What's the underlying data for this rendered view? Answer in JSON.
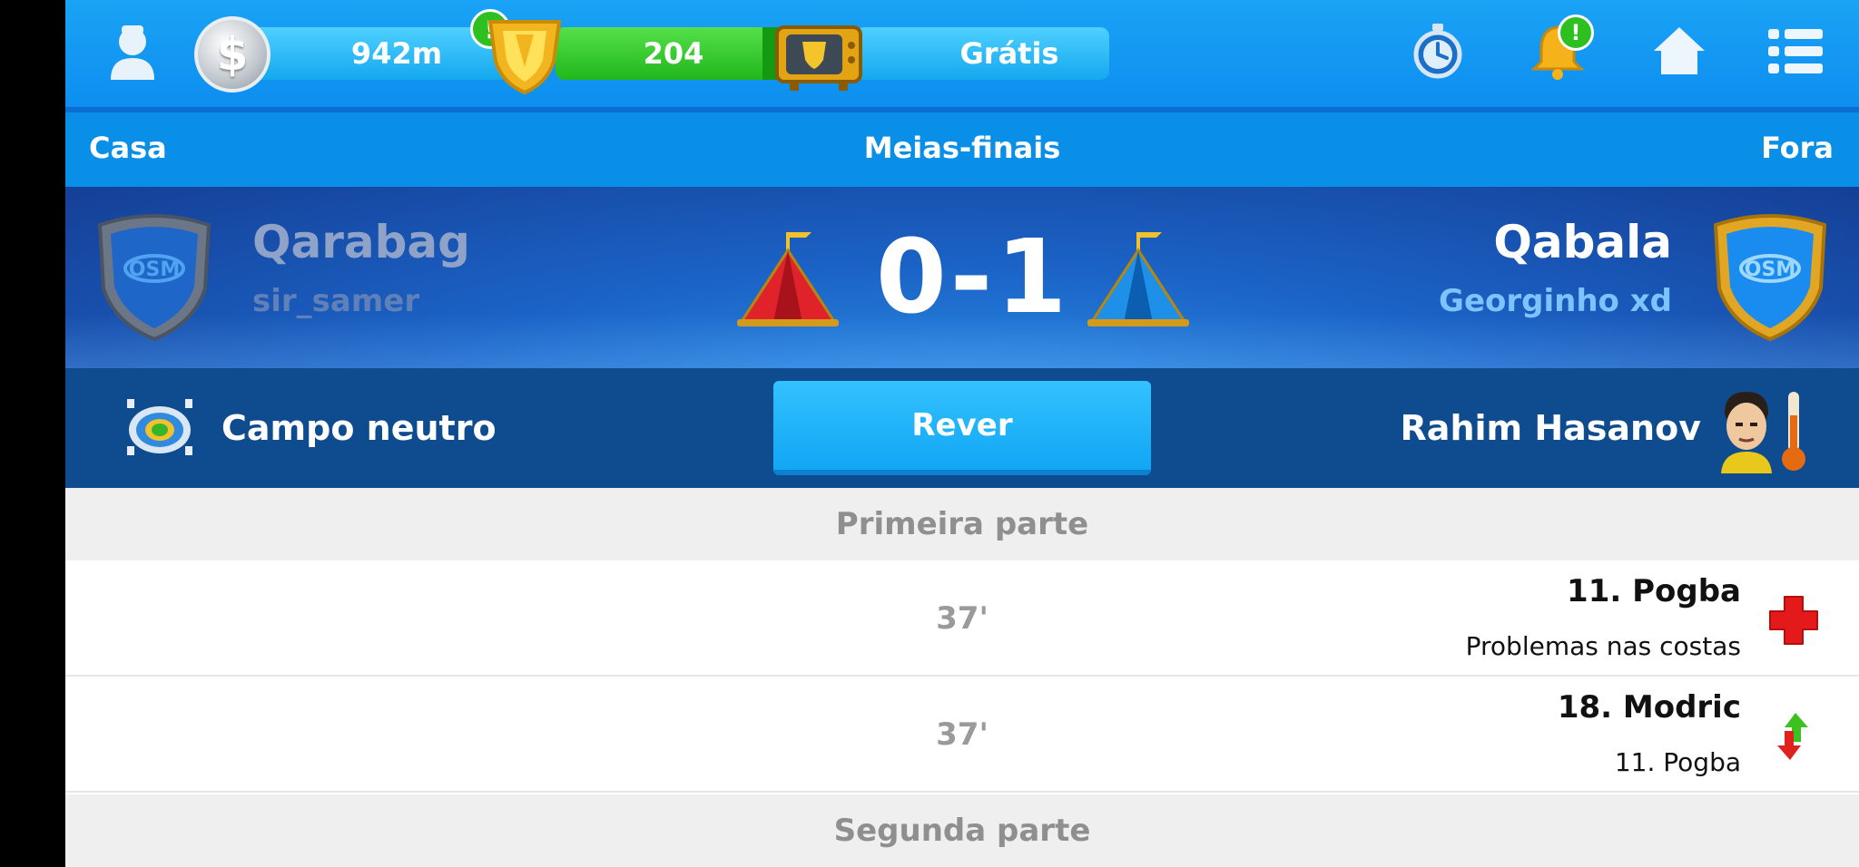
{
  "topbar": {
    "money": "942m",
    "money_alert": "!",
    "tokens": "204",
    "tokens_plus": "+",
    "tv_label": "Grátis",
    "notif_alert": "!",
    "icons": [
      "avatar-icon",
      "coin-icon",
      "token-shield-icon",
      "tv-icon",
      "stopwatch-icon",
      "bell-icon",
      "home-icon",
      "menu-icon"
    ]
  },
  "round": {
    "home_label": "Casa",
    "title": "Meias-finais",
    "away_label": "Fora"
  },
  "match": {
    "home_team": "Qarabag",
    "home_manager": "sir_samer",
    "score": "0-1",
    "away_team": "Qabala",
    "away_manager": "Georginho xd",
    "badge_text": "OSM"
  },
  "info": {
    "venue": "Campo neutro",
    "button": "Rever",
    "referee": "Rahim Hasanov"
  },
  "events": {
    "first_half": "Primeira parte",
    "items": [
      {
        "minute": "37'",
        "player": "11. Pogba",
        "detail": "Problemas nas costas",
        "type": "injury"
      },
      {
        "minute": "37'",
        "player": "18. Modric",
        "detail": "11. Pogba",
        "type": "substitution"
      }
    ],
    "second_half": "Segunda parte"
  },
  "colors": {
    "topbar": "#1aa3f5",
    "round_bar": "#0a8fe8",
    "banner": "#1b63c6",
    "info_bar": "#0e4b8f",
    "button": "#12a6f4",
    "home_team_text": "#8fa3c8",
    "away_manager_text": "#7cc4ff"
  }
}
